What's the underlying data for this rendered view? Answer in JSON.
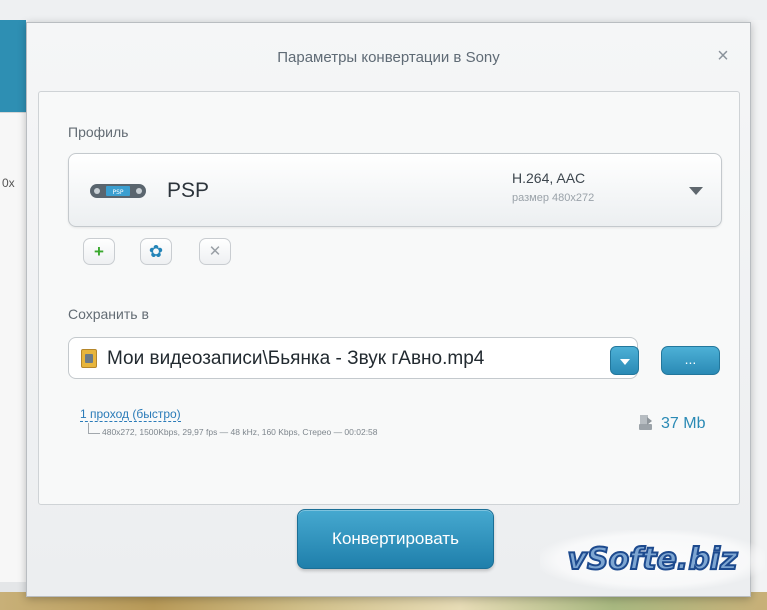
{
  "background": {
    "left_fragment_text": "0x"
  },
  "dialog": {
    "title": "Параметры конвертации в Sony",
    "close_icon": "×"
  },
  "profile": {
    "label": "Профиль",
    "name": "PSP",
    "codec": "H.264, AAC",
    "size": "размер 480x272",
    "icon": "psp-device-icon"
  },
  "profile_actions": {
    "add_icon": "+",
    "settings_icon": "✿",
    "delete_icon": "✕"
  },
  "save": {
    "label": "Сохранить в",
    "path": "Мои видеозаписи\\Бьянка - Звук гАвно.mp4",
    "browse_label": "..."
  },
  "encoding": {
    "pass_mode": "1 проход (быстро)",
    "details": "480x272, 1500Kbps, 29,97 fps — 48 kHz, 160 Kbps, Стерео — 00:02:58",
    "estimated_size": "37 Mb"
  },
  "actions": {
    "convert_label": "Конвертировать"
  },
  "watermark": {
    "text": "vSofte.biz"
  },
  "colors": {
    "accent": "#2a8ab5",
    "link": "#2a7bb8",
    "add_green": "#3aa82e"
  }
}
